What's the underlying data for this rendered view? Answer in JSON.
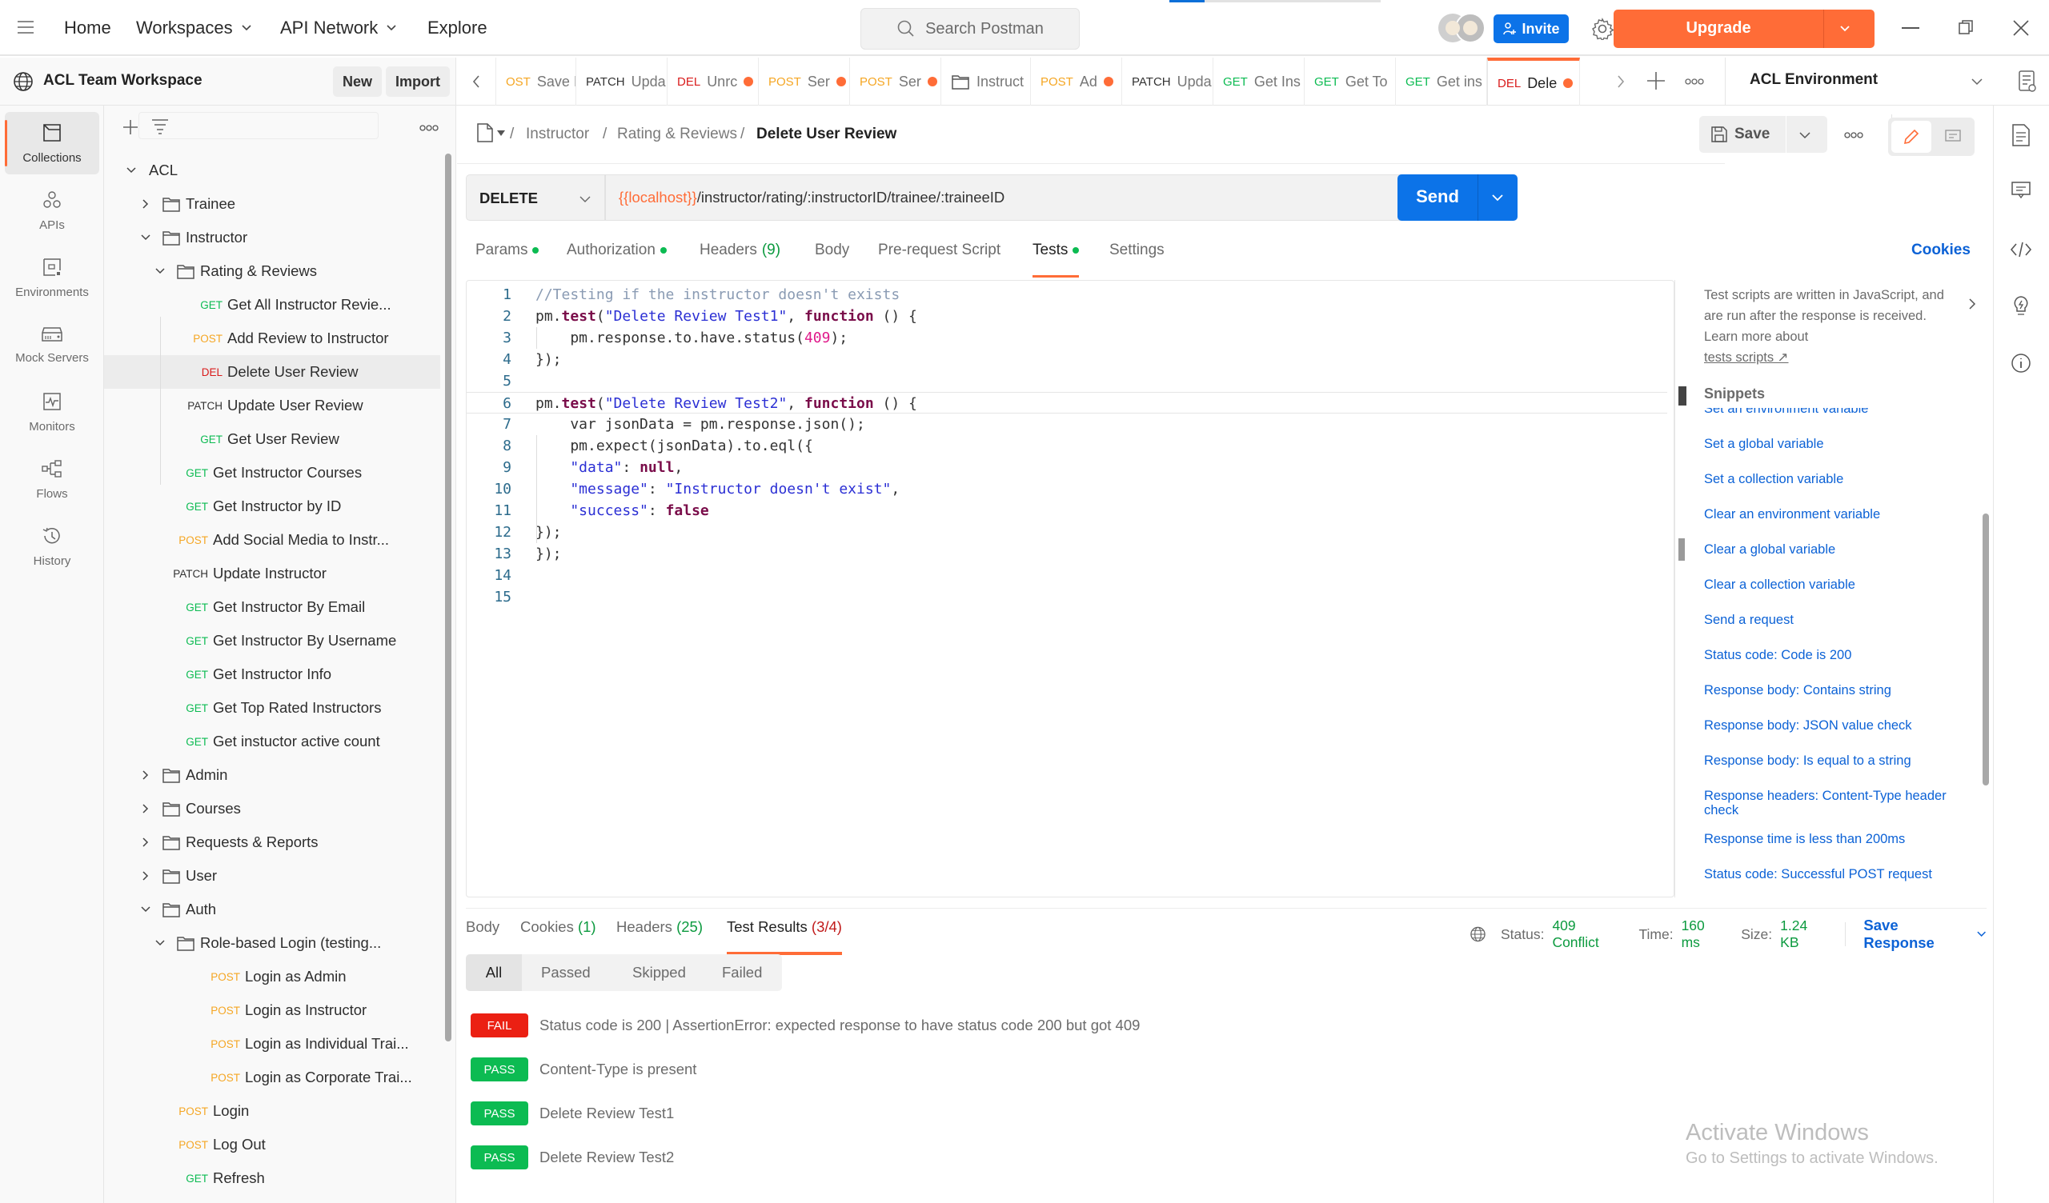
{
  "header": {
    "nav": [
      "Home",
      "Workspaces",
      "API Network",
      "Explore"
    ],
    "search_placeholder": "Search Postman",
    "invite_label": "Invite",
    "upgrade_label": "Upgrade"
  },
  "workspace": {
    "name": "ACL Team Workspace",
    "new_label": "New",
    "import_label": "Import"
  },
  "tabs": [
    {
      "method": "OST",
      "name": "Save I",
      "color": "#f5a623",
      "dot": false
    },
    {
      "method": "PATCH",
      "name": "Upda",
      "color": "#333333",
      "dot": false
    },
    {
      "method": "DEL",
      "name": "Unrc",
      "color": "#d91c1c",
      "dot": true
    },
    {
      "method": "POST",
      "name": "Ser",
      "color": "#f5a623",
      "dot": true
    },
    {
      "method": "POST",
      "name": "Ser",
      "color": "#f5a623",
      "dot": true
    },
    {
      "method": "",
      "name": "Instruct",
      "color": "#333333",
      "dot": false,
      "folder": true
    },
    {
      "method": "POST",
      "name": "Ad",
      "color": "#f5a623",
      "dot": true
    },
    {
      "method": "PATCH",
      "name": "Upda",
      "color": "#333333",
      "dot": false
    },
    {
      "method": "GET",
      "name": "Get Ins",
      "color": "#0cbb52",
      "dot": false
    },
    {
      "method": "GET",
      "name": "Get To",
      "color": "#0cbb52",
      "dot": false
    },
    {
      "method": "GET",
      "name": "Get ins",
      "color": "#0cbb52",
      "dot": false
    },
    {
      "method": "DEL",
      "name": "Dele",
      "color": "#d91c1c",
      "dot": true,
      "active": true
    }
  ],
  "environment": {
    "name": "ACL Environment"
  },
  "iconbar": [
    {
      "label": "Collections",
      "icon": "collections-icon",
      "active": true
    },
    {
      "label": "APIs",
      "icon": "apis-icon"
    },
    {
      "label": "Environments",
      "icon": "environments-icon"
    },
    {
      "label": "Mock Servers",
      "icon": "mock-servers-icon"
    },
    {
      "label": "Monitors",
      "icon": "monitors-icon"
    },
    {
      "label": "Flows",
      "icon": "flows-icon"
    },
    {
      "label": "History",
      "icon": "history-icon"
    }
  ],
  "tree": [
    {
      "type": "collection",
      "label": "ACL",
      "level": 0,
      "expanded": true
    },
    {
      "type": "folder",
      "label": "Trainee",
      "level": 1,
      "expanded": false
    },
    {
      "type": "folder",
      "label": "Instructor",
      "level": 1,
      "expanded": true
    },
    {
      "type": "folder",
      "label": "Rating & Reviews",
      "level": 2,
      "expanded": true
    },
    {
      "type": "request",
      "method": "GET",
      "label": "Get All Instructor Revie...",
      "level": 3
    },
    {
      "type": "request",
      "method": "POST",
      "label": "Add Review to Instructor",
      "level": 3
    },
    {
      "type": "request",
      "method": "DEL",
      "label": "Delete User Review",
      "level": 3,
      "selected": true
    },
    {
      "type": "request",
      "method": "PATCH",
      "label": "Update User Review",
      "level": 3
    },
    {
      "type": "request",
      "method": "GET",
      "label": "Get User Review",
      "level": 3
    },
    {
      "type": "request",
      "method": "GET",
      "label": "Get Instructor Courses",
      "level": 2
    },
    {
      "type": "request",
      "method": "GET",
      "label": "Get Instructor by ID",
      "level": 2
    },
    {
      "type": "request",
      "method": "POST",
      "label": "Add Social Media to Instr...",
      "level": 2
    },
    {
      "type": "request",
      "method": "PATCH",
      "label": "Update Instructor",
      "level": 2
    },
    {
      "type": "request",
      "method": "GET",
      "label": "Get Instructor By Email",
      "level": 2
    },
    {
      "type": "request",
      "method": "GET",
      "label": "Get Instructor By Username",
      "level": 2
    },
    {
      "type": "request",
      "method": "GET",
      "label": "Get Instructor Info",
      "level": 2
    },
    {
      "type": "request",
      "method": "GET",
      "label": "Get Top Rated Instructors",
      "level": 2
    },
    {
      "type": "request",
      "method": "GET",
      "label": "Get instuctor active count",
      "level": 2
    },
    {
      "type": "folder",
      "label": "Admin",
      "level": 1,
      "expanded": false
    },
    {
      "type": "folder",
      "label": "Courses",
      "level": 1,
      "expanded": false
    },
    {
      "type": "folder",
      "label": "Requests & Reports",
      "level": 1,
      "expanded": false
    },
    {
      "type": "folder",
      "label": "User",
      "level": 1,
      "expanded": false
    },
    {
      "type": "folder",
      "label": "Auth",
      "level": 1,
      "expanded": true
    },
    {
      "type": "folder",
      "label": "Role-based Login (testing...",
      "level": 2,
      "expanded": true
    },
    {
      "type": "request",
      "method": "POST",
      "label": "Login as Admin",
      "level": 3
    },
    {
      "type": "request",
      "method": "POST",
      "label": "Login as Instructor",
      "level": 3
    },
    {
      "type": "request",
      "method": "POST",
      "label": "Login as Individual Trai...",
      "level": 3
    },
    {
      "type": "request",
      "method": "POST",
      "label": "Login as Corporate Trai...",
      "level": 3
    },
    {
      "type": "request",
      "method": "POST",
      "label": "Login",
      "level": 2
    },
    {
      "type": "request",
      "method": "POST",
      "label": "Log Out",
      "level": 2
    },
    {
      "type": "request",
      "method": "GET",
      "label": "Refresh",
      "level": 2
    }
  ],
  "method_colors": {
    "GET": "#0cbb52",
    "POST": "#f5a623",
    "DEL": "#d91c1c",
    "PATCH": "#333333"
  },
  "breadcrumb": [
    "Instructor",
    "Rating & Reviews",
    "Delete User Review"
  ],
  "save_label": "Save",
  "request": {
    "method": "DELETE",
    "url_variable": "{{localhost}}",
    "url_path": "/instructor/rating/:instructorID/trainee/:traineeID",
    "send_label": "Send"
  },
  "request_tabs": [
    {
      "label": "Params",
      "dot": true
    },
    {
      "label": "Authorization",
      "dot": true
    },
    {
      "label": "Headers",
      "count": "(9)"
    },
    {
      "label": "Body"
    },
    {
      "label": "Pre-request Script"
    },
    {
      "label": "Tests",
      "dot": true,
      "active": true
    },
    {
      "label": "Settings"
    }
  ],
  "cookies_label": "Cookies",
  "code_lines": [
    [
      [
        "c",
        "//Testing if the instructor doesn't exists"
      ]
    ],
    [
      [
        "p",
        "pm."
      ],
      [
        "k",
        "test"
      ],
      [
        "p",
        "("
      ],
      [
        "s",
        "\"Delete Review Test1\""
      ],
      [
        "p",
        ", "
      ],
      [
        "k",
        "function"
      ],
      [
        "p",
        " () {"
      ]
    ],
    [
      [
        "p",
        "    pm.response.to.have.status("
      ],
      [
        "n",
        "409"
      ],
      [
        "p",
        ");"
      ]
    ],
    [
      [
        "p",
        "});"
      ]
    ],
    [],
    [
      [
        "p",
        "pm."
      ],
      [
        "k",
        "test"
      ],
      [
        "p",
        "("
      ],
      [
        "s",
        "\"Delete Review Test2\""
      ],
      [
        "p",
        ", "
      ],
      [
        "k",
        "function"
      ],
      [
        "p",
        " () {"
      ]
    ],
    [
      [
        "p",
        "    var jsonData = pm.response.json();"
      ]
    ],
    [
      [
        "p",
        "    pm.expect(jsonData).to.eql({"
      ]
    ],
    [
      [
        "s",
        "    \"data\""
      ],
      [
        "p",
        ": "
      ],
      [
        "k",
        "null"
      ],
      [
        "p",
        ","
      ]
    ],
    [
      [
        "s",
        "    \"message\""
      ],
      [
        "p",
        ": "
      ],
      [
        "s",
        "\"Instructor doesn't exist\""
      ],
      [
        "p",
        ","
      ]
    ],
    [
      [
        "s",
        "    \"success\""
      ],
      [
        "p",
        ": "
      ],
      [
        "k",
        "false"
      ]
    ],
    [
      [
        "p",
        "});"
      ]
    ],
    [
      [
        "p",
        "});"
      ]
    ],
    [],
    []
  ],
  "info": {
    "description": "Test scripts are written in JavaScript, and are run after the response is received. Learn more about",
    "link": "tests scripts ↗",
    "snippets_title": "Snippets",
    "snippets": [
      "Set an environment variable",
      "Set a global variable",
      "Set a collection variable",
      "Clear an environment variable",
      "Clear a global variable",
      "Clear a collection variable",
      "Send a request",
      "Status code: Code is 200",
      "Response body: Contains string",
      "Response body: JSON value check",
      "Response body: Is equal to a string",
      "Response headers: Content-Type header check",
      "Response time is less than 200ms",
      "Status code: Successful POST request"
    ]
  },
  "response": {
    "tabs": [
      {
        "label": "Body"
      },
      {
        "label": "Cookies",
        "count": "(1)",
        "count_color": "green"
      },
      {
        "label": "Headers",
        "count": "(25)",
        "count_color": "green"
      },
      {
        "label": "Test Results",
        "count": "(3/4)",
        "count_color": "red",
        "active": true
      }
    ],
    "status_label": "Status:",
    "status_value": "409 Conflict",
    "time_label": "Time:",
    "time_value": "160 ms",
    "size_label": "Size:",
    "size_value": "1.24 KB",
    "save_response_label": "Save Response",
    "filters": [
      "All",
      "Passed",
      "Skipped",
      "Failed"
    ],
    "results": [
      {
        "status": "FAIL",
        "text": "Status code is 200 | AssertionError: expected response to have status code 200 but got 409"
      },
      {
        "status": "PASS",
        "text": "Content-Type is present"
      },
      {
        "status": "PASS",
        "text": "Delete Review Test1"
      },
      {
        "status": "PASS",
        "text": "Delete Review Test2"
      }
    ]
  },
  "watermark": {
    "title": "Activate Windows",
    "subtitle": "Go to Settings to activate Windows."
  }
}
